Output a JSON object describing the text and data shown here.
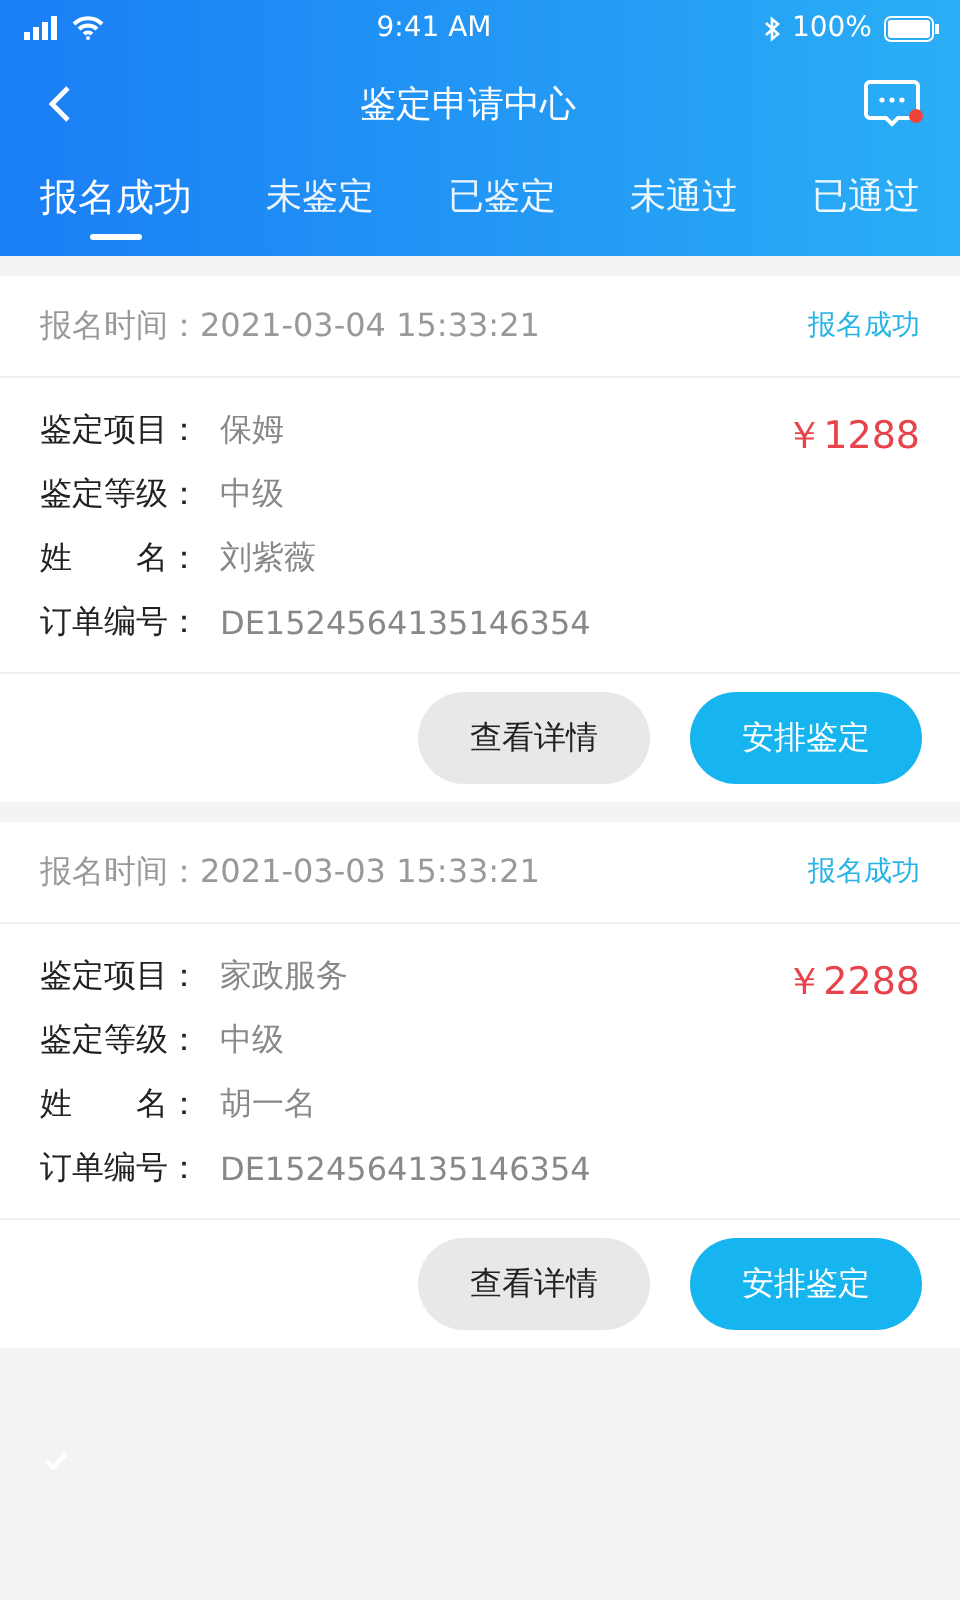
{
  "status_bar": {
    "time": "9:41 AM",
    "battery": "100%"
  },
  "nav": {
    "title": "鉴定申请中心",
    "has_unread": true
  },
  "tabs": [
    {
      "label": "报名成功",
      "selected": true
    },
    {
      "label": "未鉴定",
      "selected": false
    },
    {
      "label": "已鉴定",
      "selected": false
    },
    {
      "label": "未通过",
      "selected": false
    },
    {
      "label": "已通过",
      "selected": false
    }
  ],
  "orders": [
    {
      "time_label": "报名时间：",
      "time": "2021-03-04 15:33:21",
      "status": "报名成功",
      "price": "￥1288",
      "fields": [
        {
          "label": "鉴定项目：",
          "value": "保姆"
        },
        {
          "label": "鉴定等级：",
          "value": "中级"
        },
        {
          "label": "姓　　名：",
          "value": "刘紫薇"
        },
        {
          "label": "订单编号：",
          "value": "DE1524564135146354"
        }
      ],
      "buttons": [
        {
          "label": "查看详情",
          "kind": "secondary"
        },
        {
          "label": "安排鉴定",
          "kind": "primary"
        }
      ]
    },
    {
      "time_label": "报名时间：",
      "time": "2021-03-03 15:33:21",
      "status": "报名成功",
      "price": "￥2288",
      "fields": [
        {
          "label": "鉴定项目：",
          "value": "家政服务"
        },
        {
          "label": "鉴定等级：",
          "value": "中级"
        },
        {
          "label": "姓　　名：",
          "value": "胡一名"
        },
        {
          "label": "订单编号：",
          "value": "DE1524564135146354"
        }
      ],
      "buttons": [
        {
          "label": "查看详情",
          "kind": "secondary"
        },
        {
          "label": "安排鉴定",
          "kind": "primary"
        }
      ]
    }
  ]
}
